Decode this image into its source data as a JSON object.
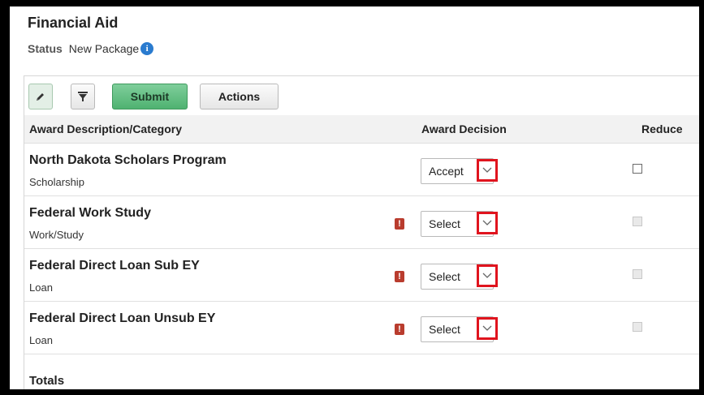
{
  "page": {
    "title": "Financial Aid",
    "status_label": "Status",
    "status_value": "New Package"
  },
  "toolbar": {
    "submit_label": "Submit",
    "actions_label": "Actions"
  },
  "table": {
    "headers": {
      "description": "Award Description/Category",
      "decision": "Award Decision",
      "reduce": "Reduce"
    },
    "rows": [
      {
        "name": "North Dakota Scholars Program",
        "category": "Scholarship",
        "decision": "Accept",
        "warning": false,
        "reduce_enabled": true
      },
      {
        "name": "Federal Work Study",
        "category": "Work/Study",
        "decision": "Select",
        "warning": true,
        "reduce_enabled": false
      },
      {
        "name": "Federal Direct Loan Sub EY",
        "category": "Loan",
        "decision": "Select",
        "warning": true,
        "reduce_enabled": false
      },
      {
        "name": "Federal Direct Loan Unsub EY",
        "category": "Loan",
        "decision": "Select",
        "warning": true,
        "reduce_enabled": false
      }
    ],
    "totals_label": "Totals"
  },
  "colors": {
    "submit_green": "#5cb97c",
    "highlight_red": "#e0141e",
    "warning_red": "#b93c2e",
    "info_blue": "#2a7bcf"
  }
}
